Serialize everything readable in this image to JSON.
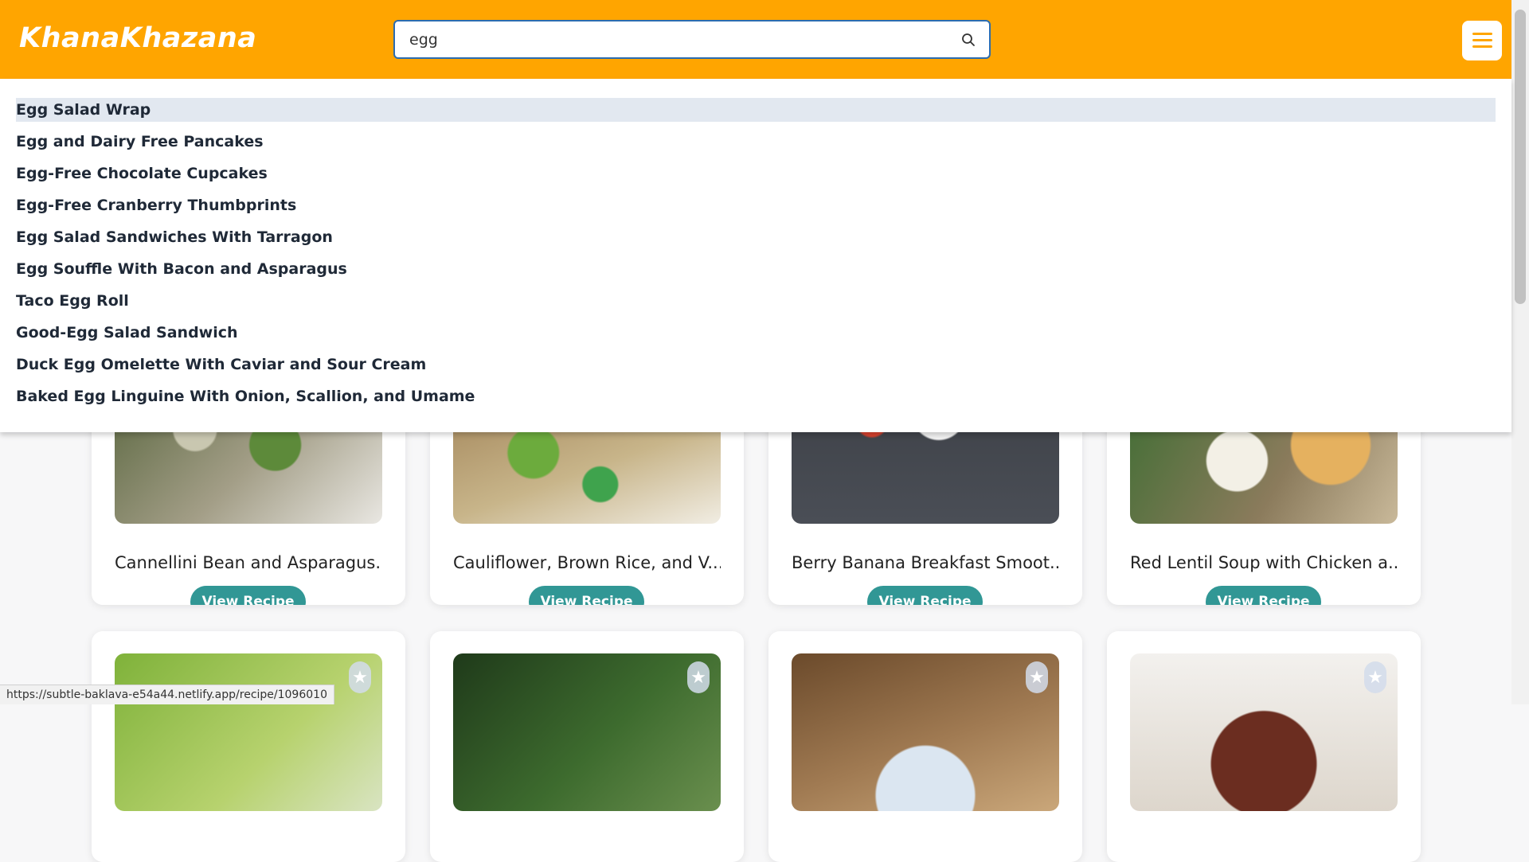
{
  "header": {
    "brand": "KhanaKhazana",
    "search_value": "egg",
    "search_icon": "search-icon",
    "menu_icon": "hamburger-menu-icon",
    "accent_color": "#ffa500"
  },
  "suggestions": [
    "Egg Salad Wrap",
    "Egg and Dairy Free Pancakes",
    "Egg-Free Chocolate Cupcakes",
    "Egg-Free Cranberry Thumbprints",
    "Egg Salad Sandwiches With Tarragon",
    "Egg Souffle With Bacon and Asparagus",
    "Taco Egg Roll",
    "Good-Egg Salad Sandwich",
    "Duck Egg Omelette With Caviar and Sour Cream",
    "Baked Egg Linguine With Onion, Scallion, and Umame"
  ],
  "recipes_row1": [
    {
      "title": "Cannellini Bean and Asparagus...",
      "button": "View Recipe"
    },
    {
      "title": "Cauliflower, Brown Rice, and V...",
      "button": "View Recipe"
    },
    {
      "title": "Berry Banana Breakfast Smoot...",
      "button": "View Recipe"
    },
    {
      "title": "Red Lentil Soup with Chicken a...",
      "button": "View Recipe"
    }
  ],
  "recipes_row2_icon": "star-icon",
  "button_color": "#319795",
  "status_url": "https://subtle-baklava-e54a44.netlify.app/recipe/1096010"
}
